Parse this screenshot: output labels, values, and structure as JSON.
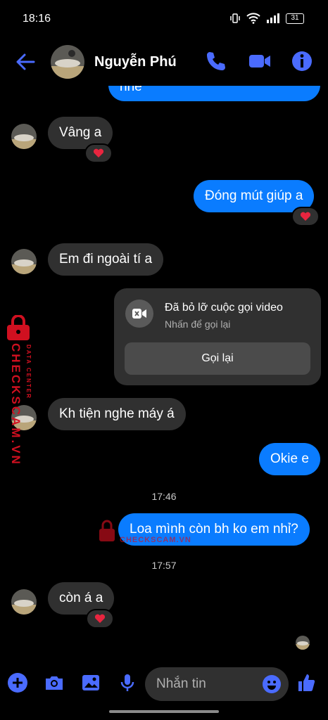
{
  "status": {
    "time": "18:16",
    "battery": "31"
  },
  "header": {
    "contact_name": "Nguyễn Phú"
  },
  "messages": {
    "top_partial": "nhé",
    "m1": "Vâng a",
    "m2": "Đóng mút giúp a",
    "m3": "Em đi ngoài tí a",
    "m4": "Kh tiện nghe máy á",
    "m5": "Okie e",
    "m6": "Loa mình còn bh ko em nhỉ?",
    "m7": "còn á a",
    "ts1": "17:46",
    "ts2": "17:57"
  },
  "missed_call": {
    "title": "Đã bỏ lỡ cuộc gọi video",
    "subtitle": "Nhấn để gọi lại",
    "button": "Gọi lại"
  },
  "watermark": {
    "brand": "CHECKSCAM.VN",
    "tag": "DATA CENTER",
    "mid": "CHECKSCAM.VN"
  },
  "composer": {
    "placeholder": "Nhắn tin"
  },
  "colors": {
    "accent": "#0a7cff",
    "bubble_in": "#303030",
    "icon_blue": "#4a6bff",
    "heart": "#e8253f"
  }
}
